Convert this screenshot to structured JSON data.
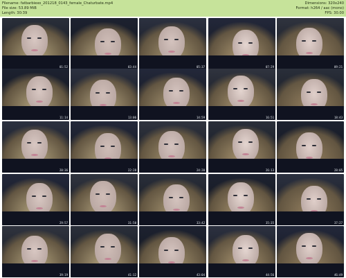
{
  "header": {
    "filename": "Filename: fatbarbiexo_201218_0143_female_Chaturbate.mp4",
    "filesize": "File size: 53.89 MiB",
    "length": "Length: 30:39",
    "dimensions": "Dimensions: 320x240",
    "format": "Format: h264 / aac (mono)",
    "fps": "FPS: 30.00"
  },
  "thumbnails": [
    {
      "time": "01:52"
    },
    {
      "time": "03:44"
    },
    {
      "time": "05:37"
    },
    {
      "time": "07:29"
    },
    {
      "time": "09:21"
    },
    {
      "time": "11:14"
    },
    {
      "time": "13:06"
    },
    {
      "time": "14:59"
    },
    {
      "time": "16:51"
    },
    {
      "time": "18:43"
    },
    {
      "time": "20:36"
    },
    {
      "time": "22:28"
    },
    {
      "time": "24:20"
    },
    {
      "time": "26:13"
    },
    {
      "time": "28:05"
    },
    {
      "time": "29:57"
    },
    {
      "time": "31:50"
    },
    {
      "time": "33:42"
    },
    {
      "time": "35:35"
    },
    {
      "time": "37:27"
    },
    {
      "time": "39:19"
    },
    {
      "time": "41:12"
    },
    {
      "time": "43:04"
    },
    {
      "time": "44:56"
    },
    {
      "time": "46:49"
    }
  ]
}
